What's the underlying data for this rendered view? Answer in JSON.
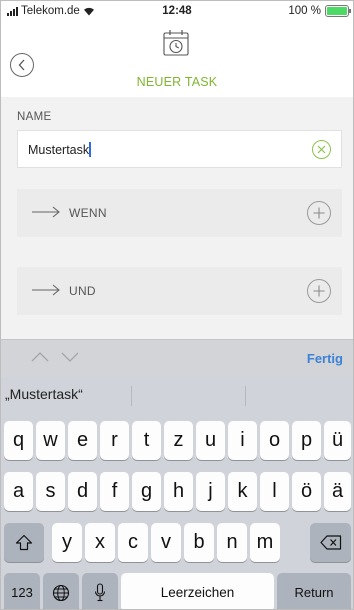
{
  "status_bar": {
    "carrier": "Telekom.de",
    "time": "12:48",
    "battery": "100 %",
    "battery_level": 1.0
  },
  "header": {
    "title": "NEUER TASK",
    "title_color": "#7fb531",
    "back_icon": "chevron-left-circle-icon",
    "title_icon": "calendar-clock-icon"
  },
  "form": {
    "name_label": "NAME",
    "name_value": "Mustertask",
    "clear_icon": "clear-circle-icon",
    "conditions": [
      {
        "label": "WENN",
        "arrow_icon": "arrow-right-icon",
        "add_icon": "plus-circle-icon"
      },
      {
        "label": "UND",
        "arrow_icon": "arrow-right-icon",
        "add_icon": "plus-circle-icon"
      }
    ]
  },
  "accessory": {
    "up_icon": "chevron-up-icon",
    "down_icon": "chevron-down-icon",
    "done_label": "Fertig",
    "done_color": "#3c82d6"
  },
  "keyboard": {
    "suggestion": "„Mustertask“",
    "rows": [
      [
        "q",
        "w",
        "e",
        "r",
        "t",
        "z",
        "u",
        "i",
        "o",
        "p",
        "ü"
      ],
      [
        "a",
        "s",
        "d",
        "f",
        "g",
        "h",
        "j",
        "k",
        "l",
        "ö",
        "ä"
      ],
      [
        "y",
        "x",
        "c",
        "v",
        "b",
        "n",
        "m"
      ]
    ],
    "shift_icon": "shift-icon",
    "backspace_icon": "backspace-icon",
    "numbers_label": "123",
    "globe_icon": "globe-icon",
    "mic_icon": "microphone-icon",
    "space_label": "Leerzeichen",
    "return_label": "Return"
  }
}
